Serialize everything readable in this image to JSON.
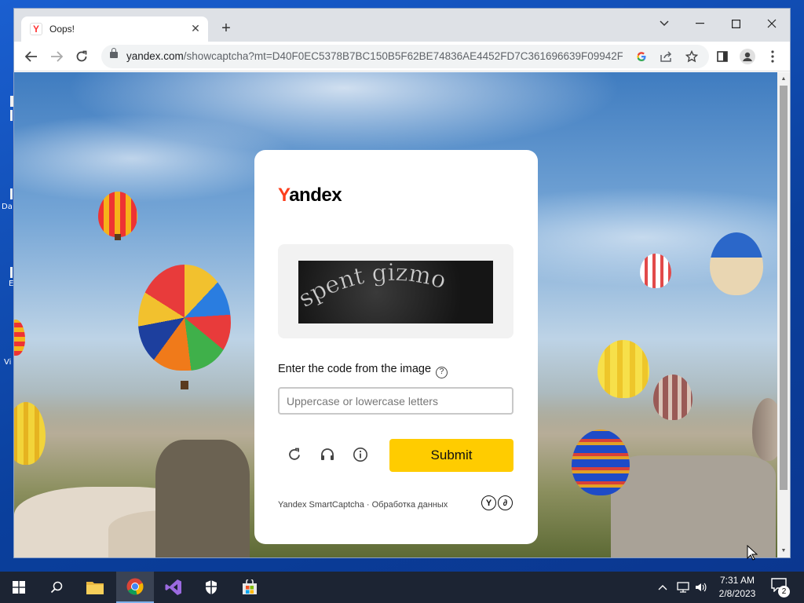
{
  "desktop": {
    "labels": [
      "Da",
      "E",
      "Vi"
    ]
  },
  "browser": {
    "tab": {
      "title": "Oops!",
      "favicon": "Y"
    },
    "url": {
      "host": "yandex.com",
      "rest": "/showcaptcha?mt=D40F0EC5378B7BC150B5F62BE74836AE4452FD7C361696639F09942F..."
    },
    "icons": [
      "back-icon",
      "forward-icon",
      "reload-icon",
      "lock-icon",
      "google-icon",
      "share-icon",
      "bookmark-star-icon",
      "side-panel-icon",
      "profile-icon",
      "menu-icon"
    ]
  },
  "captcha": {
    "logo": {
      "y": "Y",
      "rest": "andex"
    },
    "image_text": "spent gizmo",
    "prompt": "Enter the code from the image",
    "input_placeholder": "Uppercase or lowercase letters",
    "input_value": "",
    "submit_label": "Submit",
    "footer": "Yandex SmartCaptcha · Обработка данных",
    "footer_marks": [
      "Y",
      "∂"
    ]
  },
  "taskbar": {
    "time": "7:31 AM",
    "date": "2/8/2023",
    "notification_count": "2",
    "accent": "#7fb1ec"
  },
  "colors": {
    "submit": "#ffcc00",
    "logo_accent": "#fc3f1d"
  }
}
